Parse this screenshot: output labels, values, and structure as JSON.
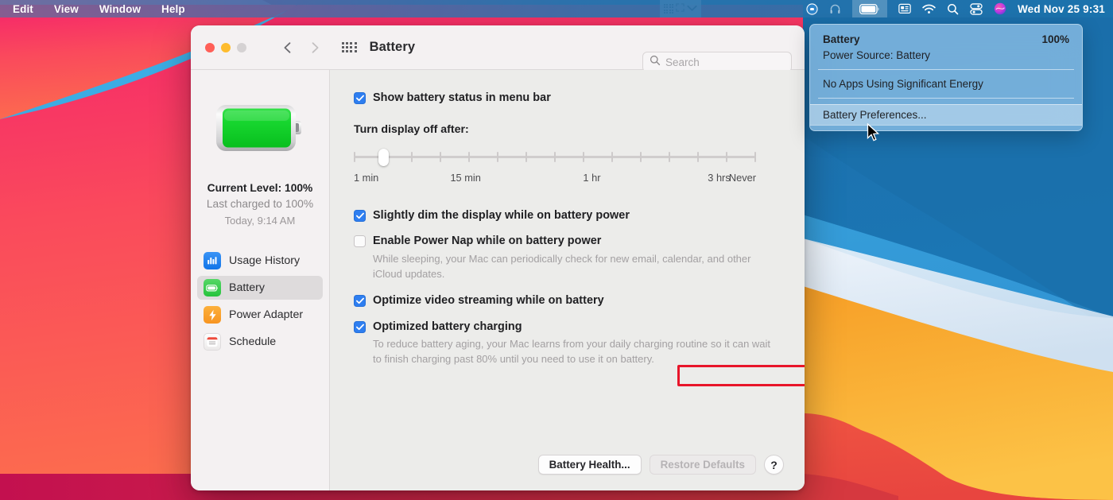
{
  "menubar": {
    "menus": [
      {
        "label": "Edit"
      },
      {
        "label": "View"
      },
      {
        "label": "Window"
      },
      {
        "label": "Help"
      }
    ],
    "widget_icons": [
      "dot-grid-icon",
      "expand-arrows-icon",
      "chevron-down-icon"
    ],
    "status_icons": [
      "accessibility-icon",
      "headphones-icon",
      "battery-icon",
      "display-icon",
      "wifi-icon",
      "search-icon",
      "control-center-icon",
      "siri-icon"
    ],
    "clock": "Wed Nov 25  9:31",
    "highlight_icon": "battery-icon"
  },
  "battery_menu": {
    "title": "Battery",
    "percent": "100%",
    "power_source": "Power Source: Battery",
    "apps_energy": "No Apps Using Significant Energy",
    "preferences": "Battery Preferences...",
    "highlighted_item": "Battery Preferences..."
  },
  "window": {
    "title": "Battery",
    "traffic_lights": [
      "close-button",
      "minimize-button",
      "zoom-button-disabled"
    ],
    "nav": {
      "back": "back-chevron-icon",
      "forward": "forward-chevron-icon-disabled"
    },
    "grid_button": "show-all-grid-icon",
    "search": {
      "placeholder": "Search",
      "value": "",
      "icon": "search-icon"
    }
  },
  "sidebar": {
    "battery_icon": "large-green-battery-icon",
    "current_level": "Current Level: 100%",
    "last_charged": "Last charged to 100%",
    "last_charged_time": "Today, 9:14 AM",
    "items": [
      {
        "label": "Usage History",
        "icon": "usage-history-icon",
        "selected": false
      },
      {
        "label": "Battery",
        "icon": "battery-icon",
        "selected": true
      },
      {
        "label": "Power Adapter",
        "icon": "power-adapter-bolt-icon",
        "selected": false
      },
      {
        "label": "Schedule",
        "icon": "schedule-calendar-icon",
        "selected": false
      }
    ]
  },
  "main": {
    "show_status": {
      "label": "Show battery status in menu bar",
      "checked": true
    },
    "slider": {
      "label": "Turn display off after:",
      "ticks": 15,
      "thumb_index": 1,
      "tick_labels": [
        {
          "text": "1 min",
          "pos_pct": 0
        },
        {
          "text": "15 min",
          "pos_pct": 24
        },
        {
          "text": "1 hr",
          "pos_pct": 57
        },
        {
          "text": "3 hrs",
          "pos_pct": 88
        },
        {
          "text": "Never",
          "pos_pct": 100
        }
      ]
    },
    "options": [
      {
        "label": "Slightly dim the display while on battery power",
        "checked": true,
        "help": ""
      },
      {
        "label": "Enable Power Nap while on battery power",
        "checked": false,
        "help": "While sleeping, your Mac can periodically check for new email, calendar, and other iCloud updates."
      },
      {
        "label": "Optimize video streaming while on battery",
        "checked": true,
        "help": ""
      },
      {
        "label": "Optimized battery charging",
        "checked": true,
        "help": "To reduce battery aging, your Mac learns from your daily charging routine so it can wait to finish charging past 80% until you need to use it on battery."
      }
    ],
    "footer": {
      "battery_health": "Battery Health...",
      "restore_defaults": "Restore Defaults",
      "help": "?"
    }
  },
  "annotation": {
    "target": "Optimized battery charging",
    "color": "#e8152a"
  },
  "colors": {
    "accent_blue": "#2e7ef0",
    "battery_green": "#26c33c",
    "annotation_red": "#e8152a",
    "window_bg": "#ececea",
    "sidebar_bg": "#f4f1f2"
  }
}
